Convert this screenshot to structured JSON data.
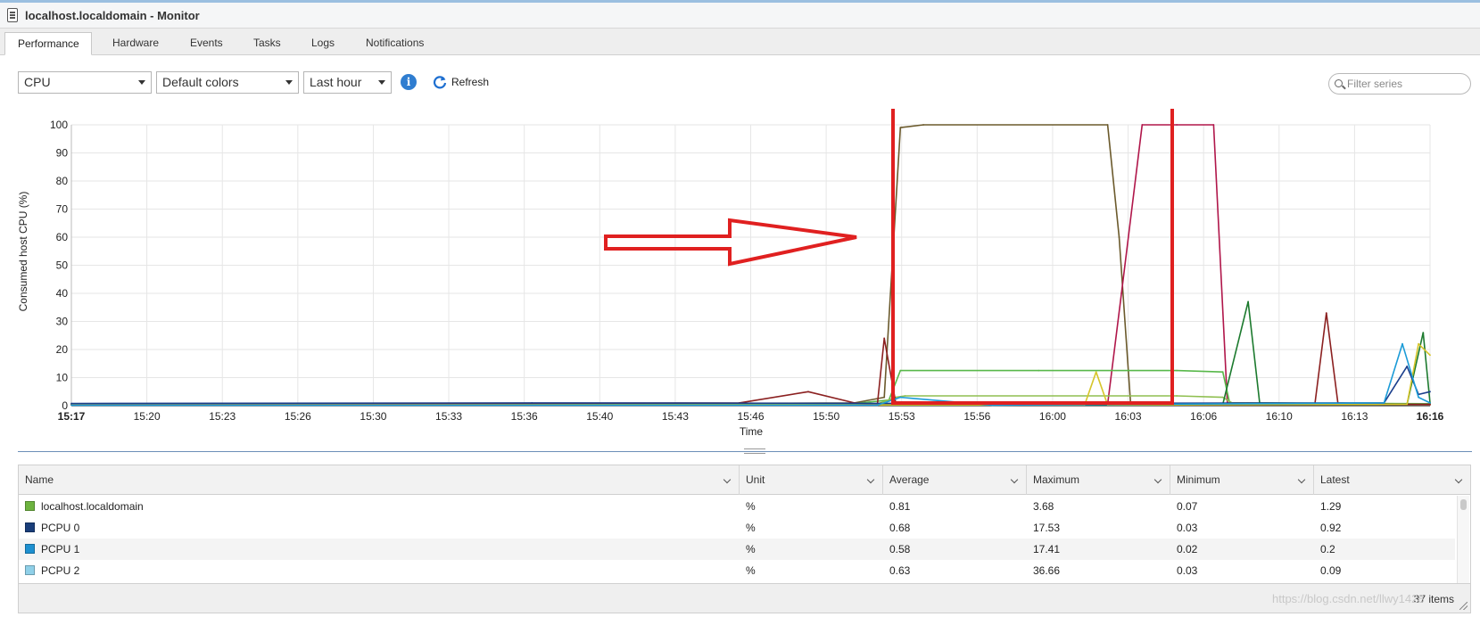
{
  "window": {
    "title": "localhost.localdomain - Monitor"
  },
  "tabs": [
    {
      "label": "Performance",
      "active": true
    },
    {
      "label": "Hardware",
      "active": false
    },
    {
      "label": "Events",
      "active": false
    },
    {
      "label": "Tasks",
      "active": false
    },
    {
      "label": "Logs",
      "active": false
    },
    {
      "label": "Notifications",
      "active": false
    }
  ],
  "toolbar": {
    "metric_select": "CPU",
    "color_select": "Default colors",
    "range_select": "Last hour",
    "info_icon": "info-icon",
    "refresh_label": "Refresh",
    "filter_placeholder": "Filter series"
  },
  "chart_data": {
    "type": "line",
    "xlabel": "Time",
    "ylabel": "Consumed host CPU (%)",
    "ylim": [
      0,
      100
    ],
    "yticks": [
      0,
      10,
      20,
      30,
      40,
      50,
      60,
      70,
      80,
      90,
      100
    ],
    "xticks": [
      "15:17",
      "15:20",
      "15:23",
      "15:26",
      "15:30",
      "15:33",
      "15:36",
      "15:40",
      "15:43",
      "15:46",
      "15:50",
      "15:53",
      "15:56",
      "16:00",
      "16:03",
      "16:06",
      "16:10",
      "16:13",
      "16:16"
    ],
    "xrange_minutes": [
      0,
      59
    ],
    "grid": true,
    "series": [
      {
        "color": "#6b5a2c",
        "points": [
          [
            0,
            0.5
          ],
          [
            10,
            0.8
          ],
          [
            20,
            0.6
          ],
          [
            34,
            1
          ],
          [
            35.3,
            3
          ],
          [
            36,
            99
          ],
          [
            37,
            100
          ],
          [
            45,
            100
          ],
          [
            45.5,
            60
          ],
          [
            46,
            0.5
          ],
          [
            59,
            0.4
          ]
        ]
      },
      {
        "color": "#b0164a",
        "points": [
          [
            0,
            0.3
          ],
          [
            20,
            0.5
          ],
          [
            40,
            0.4
          ],
          [
            45,
            0.5
          ],
          [
            45.6,
            40
          ],
          [
            46.5,
            100
          ],
          [
            48,
            100
          ],
          [
            49.6,
            100
          ],
          [
            50.2,
            1
          ],
          [
            59,
            0.3
          ]
        ]
      },
      {
        "color": "#58b84a",
        "points": [
          [
            0,
            0.5
          ],
          [
            10,
            0.6
          ],
          [
            34,
            0.8
          ],
          [
            35.5,
            2
          ],
          [
            36,
            12.5
          ],
          [
            42,
            12.5
          ],
          [
            48,
            12.5
          ],
          [
            50,
            12
          ],
          [
            50.3,
            1
          ],
          [
            59,
            0.7
          ]
        ]
      },
      {
        "color": "#8fbf50",
        "points": [
          [
            0,
            0.4
          ],
          [
            30,
            0.5
          ],
          [
            35,
            0.6
          ],
          [
            35.8,
            3
          ],
          [
            36.2,
            3.5
          ],
          [
            48,
            3.5
          ],
          [
            50,
            3
          ],
          [
            50.5,
            0.5
          ],
          [
            59,
            0.4
          ]
        ]
      },
      {
        "color": "#1c7a2e",
        "points": [
          [
            0,
            0.3
          ],
          [
            48,
            0.3
          ],
          [
            50,
            0.5
          ],
          [
            51.1,
            37
          ],
          [
            51.6,
            1
          ],
          [
            58,
            0.5
          ],
          [
            58.7,
            26
          ],
          [
            59,
            1
          ]
        ]
      },
      {
        "color": "#8b2020",
        "points": [
          [
            0,
            0.5
          ],
          [
            29,
            1
          ],
          [
            32,
            5
          ],
          [
            34,
            1
          ],
          [
            35,
            0.5
          ],
          [
            35.3,
            24
          ],
          [
            35.8,
            1
          ],
          [
            54,
            0.5
          ],
          [
            54.5,
            33
          ],
          [
            55,
            1
          ],
          [
            57,
            0.5
          ],
          [
            59,
            0.5
          ]
        ]
      },
      {
        "color": "#d6c52a",
        "points": [
          [
            0,
            0.3
          ],
          [
            44,
            0.3
          ],
          [
            44.5,
            12
          ],
          [
            45,
            0.3
          ],
          [
            58,
            0.5
          ],
          [
            58.5,
            22
          ],
          [
            59,
            18
          ]
        ]
      },
      {
        "color": "#1a3e8c",
        "points": [
          [
            0,
            0.8
          ],
          [
            20,
            1
          ],
          [
            40,
            0.8
          ],
          [
            57,
            1
          ],
          [
            58,
            14
          ],
          [
            58.5,
            4
          ],
          [
            59,
            5
          ]
        ]
      },
      {
        "color": "#1b9bd7",
        "points": [
          [
            0,
            0.2
          ],
          [
            35,
            0.2
          ],
          [
            36,
            3
          ],
          [
            40,
            0.2
          ],
          [
            57,
            1
          ],
          [
            57.8,
            22
          ],
          [
            58.5,
            3
          ],
          [
            59,
            1
          ]
        ]
      }
    ]
  },
  "table": {
    "columns": [
      "Name",
      "Unit",
      "Average",
      "Maximum",
      "Minimum",
      "Latest"
    ],
    "rows": [
      {
        "color": "#6db33f",
        "name": "localhost.localdomain",
        "unit": "%",
        "average": "0.81",
        "maximum": "3.68",
        "minimum": "0.07",
        "latest": "1.29"
      },
      {
        "color": "#1a3e7a",
        "name": "PCPU 0",
        "unit": "%",
        "average": "0.68",
        "maximum": "17.53",
        "minimum": "0.03",
        "latest": "0.92"
      },
      {
        "color": "#1e90d0",
        "name": "PCPU 1",
        "unit": "%",
        "average": "0.58",
        "maximum": "17.41",
        "minimum": "0.02",
        "latest": "0.2"
      },
      {
        "color": "#8fd0e8",
        "name": "PCPU 2",
        "unit": "%",
        "average": "0.63",
        "maximum": "36.66",
        "minimum": "0.03",
        "latest": "0.09"
      }
    ],
    "footer_count": "37 items"
  },
  "annotation": {
    "color": "#e02020"
  },
  "watermark": "https://blog.csdn.net/llwy1428"
}
